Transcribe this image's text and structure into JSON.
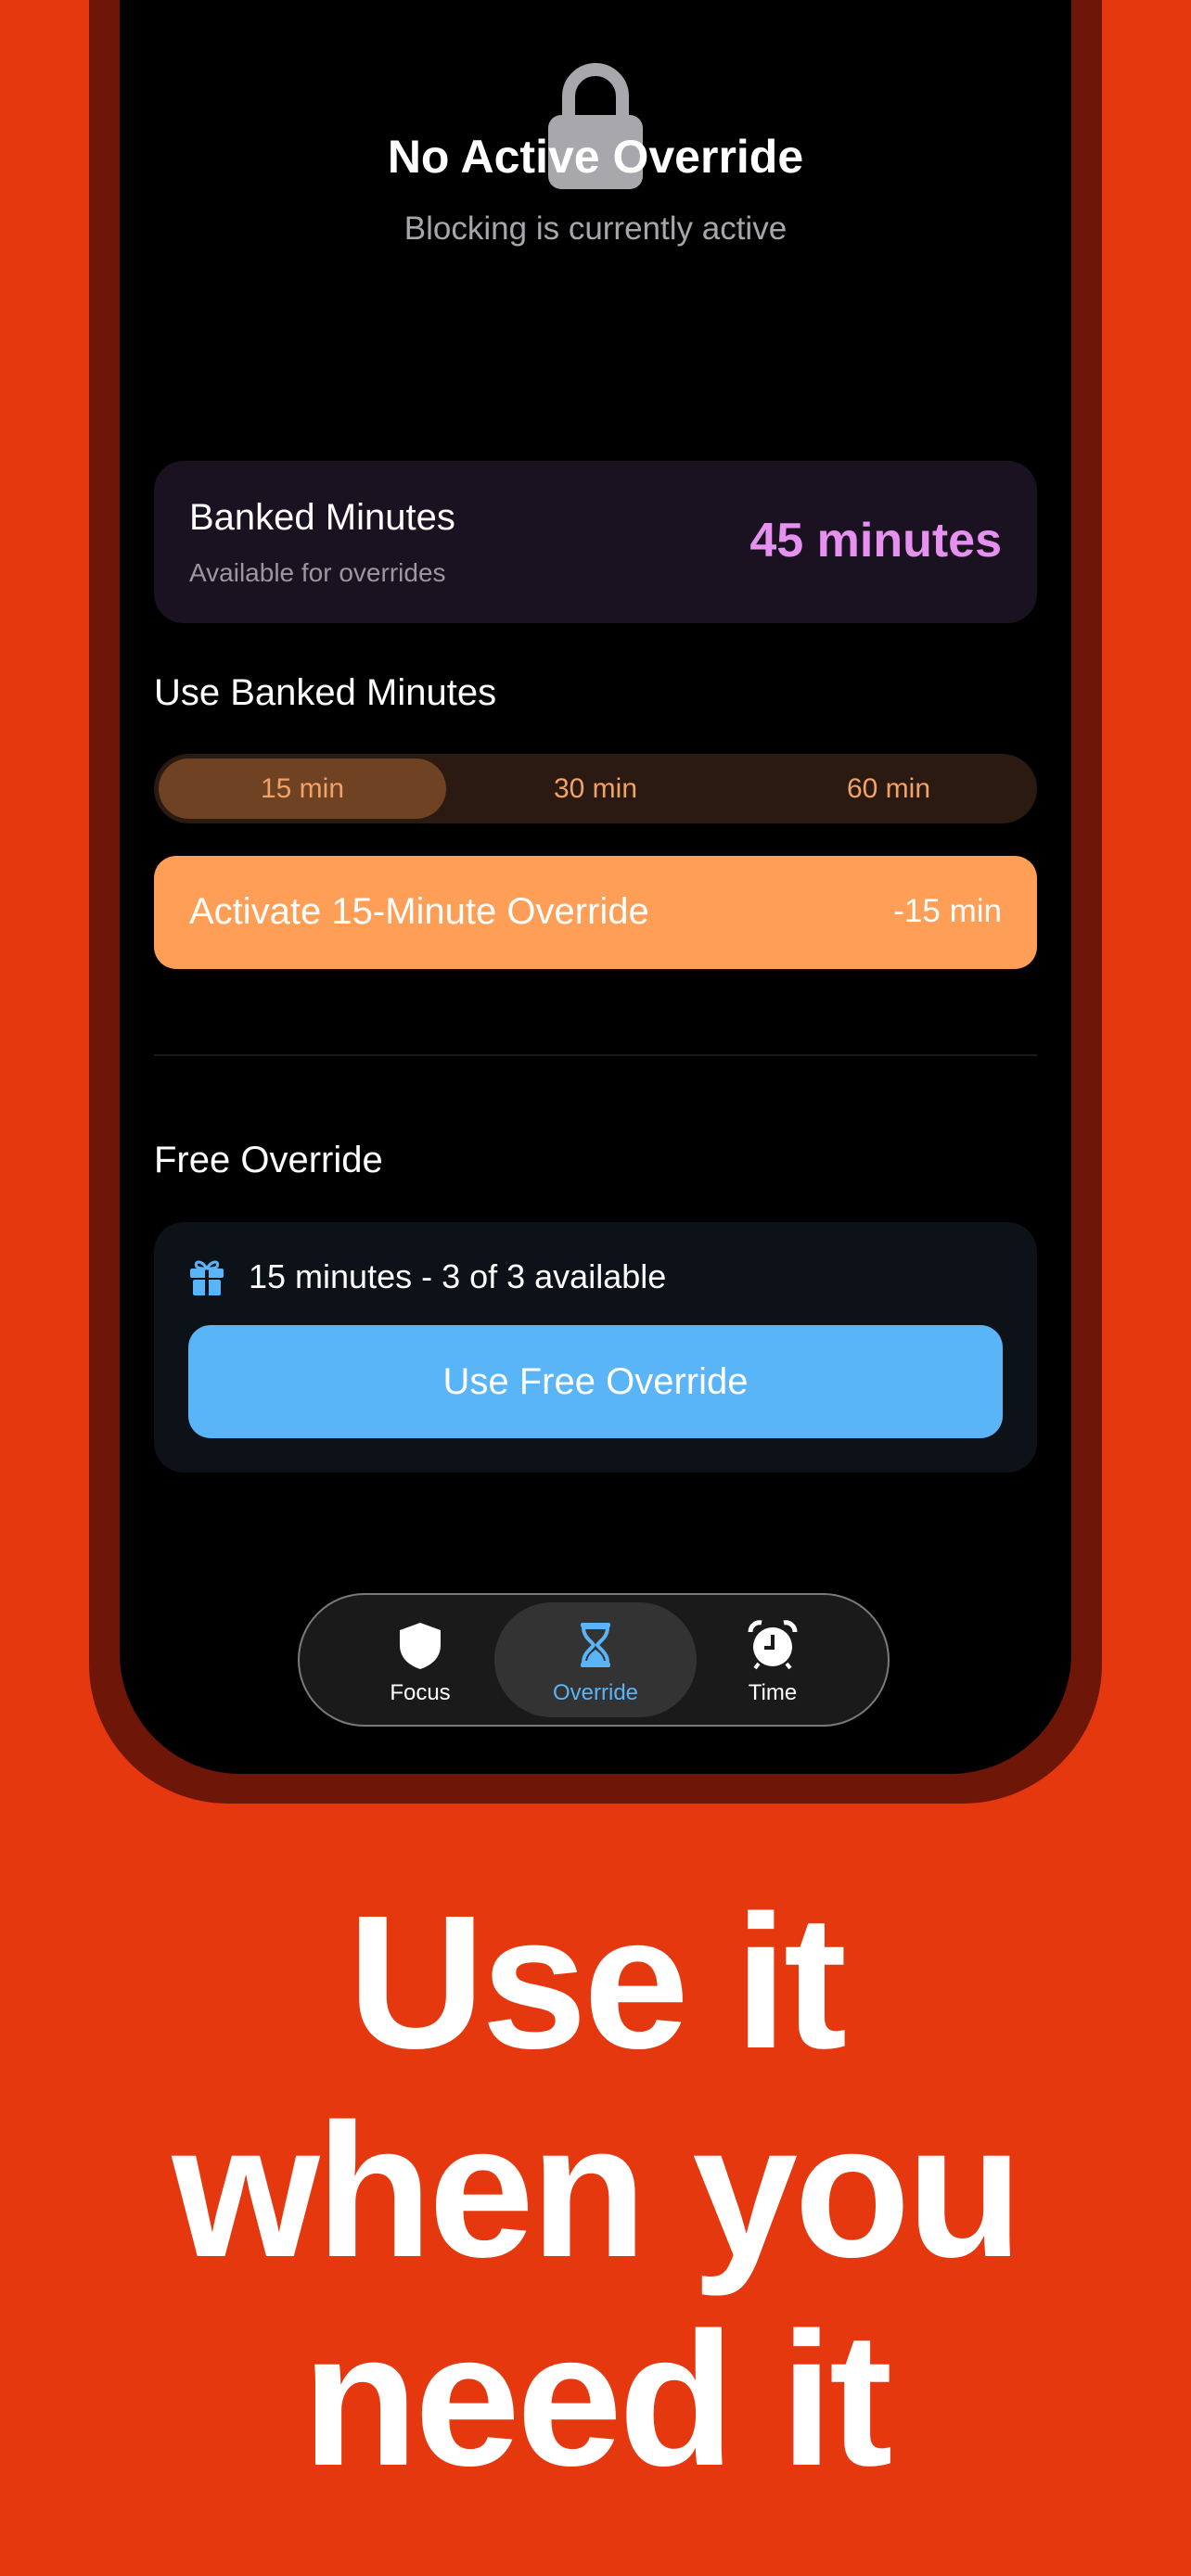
{
  "colors": {
    "background": "#E5380F",
    "accent_purple": "#E691F0",
    "accent_orange": "#FF9F57",
    "accent_blue": "#5AB4F8"
  },
  "status": {
    "icon": "lock-icon",
    "title": "No Active Override",
    "subtitle": "Blocking is currently active"
  },
  "banked": {
    "title": "Banked Minutes",
    "subtitle": "Available for overrides",
    "value": "45 minutes"
  },
  "use_banked": {
    "label": "Use Banked Minutes",
    "options": [
      "15 min",
      "30 min",
      "60 min"
    ],
    "selected": "15 min",
    "activate_label": "Activate 15-Minute Override",
    "activate_cost": "-15 min"
  },
  "free_override": {
    "label": "Free Override",
    "icon": "gift-icon",
    "info": "15 minutes - 3 of 3 available",
    "button": "Use Free Override"
  },
  "tabbar": {
    "tabs": [
      {
        "label": "Focus",
        "icon": "shield-icon"
      },
      {
        "label": "Override",
        "icon": "hourglass-icon",
        "active": true
      },
      {
        "label": "Time",
        "icon": "alarm-clock-icon"
      }
    ]
  },
  "headline": {
    "line1": "Use it",
    "line2": "when you",
    "line3": "need it"
  }
}
